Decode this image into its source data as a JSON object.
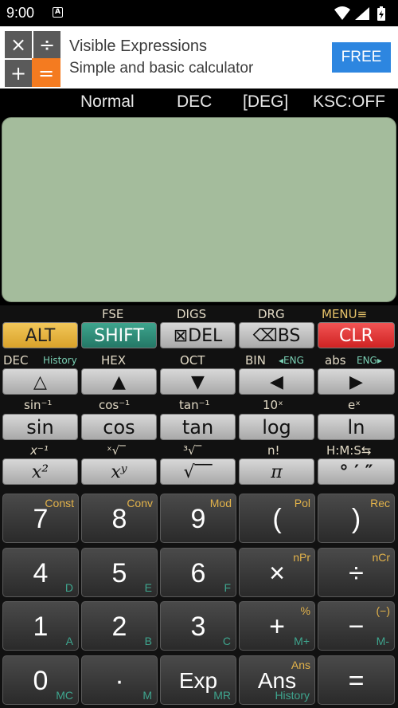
{
  "status": {
    "time": "9:00",
    "notif_icon": "A"
  },
  "ad": {
    "title": "Visible Expressions",
    "subtitle": "Simple and basic calculator",
    "button": "FREE",
    "logo_symbols": [
      "×",
      "÷",
      "+",
      "="
    ]
  },
  "modes": {
    "notation": "Normal",
    "base": "DEC",
    "angle": "[DEG]",
    "ksc": "KSC:OFF"
  },
  "row1": {
    "labels": [
      "FSE",
      "DIGS",
      "DRG",
      "MENU≡"
    ],
    "keys": [
      "ALT",
      "SHIFT",
      "⊠DEL",
      "⌫BS",
      "CLR"
    ]
  },
  "row2": {
    "labels": [
      "DEC",
      "History",
      "HEX",
      "OCT",
      "BIN",
      "◂ENG",
      "abs",
      "ENG▸"
    ],
    "keys": [
      "△",
      "▲",
      "▼",
      "◀",
      "▶"
    ]
  },
  "row3": {
    "labels": [
      "sin⁻¹",
      "cos⁻¹",
      "tan⁻¹",
      "10ˣ",
      "eˣ"
    ],
    "keys": [
      "sin",
      "cos",
      "tan",
      "log",
      "ln"
    ]
  },
  "row4": {
    "labels": [
      "x⁻¹",
      "ˣ√‾",
      "³√‾",
      "n!",
      "H:M:S⇆"
    ],
    "keys": [
      "x²",
      "xʸ",
      "√‾‾",
      "π",
      "° ′ ″"
    ]
  },
  "numpad": [
    [
      {
        "main": "7",
        "top": "Const",
        "bot": ""
      },
      {
        "main": "8",
        "top": "Conv",
        "bot": ""
      },
      {
        "main": "9",
        "top": "Mod",
        "bot": ""
      },
      {
        "main": "(",
        "top": "Pol",
        "bot": ""
      },
      {
        "main": ")",
        "top": "Rec",
        "bot": ""
      }
    ],
    [
      {
        "main": "4",
        "top": "",
        "bot": "D"
      },
      {
        "main": "5",
        "top": "",
        "bot": "E"
      },
      {
        "main": "6",
        "top": "",
        "bot": "F"
      },
      {
        "main": "×",
        "top": "nPr",
        "bot": ""
      },
      {
        "main": "÷",
        "top": "nCr",
        "bot": ""
      }
    ],
    [
      {
        "main": "1",
        "top": "",
        "bot": "A"
      },
      {
        "main": "2",
        "top": "",
        "bot": "B"
      },
      {
        "main": "3",
        "top": "",
        "bot": "C"
      },
      {
        "main": "+",
        "top": "%",
        "bot": "M+"
      },
      {
        "main": "−",
        "top": "(−)",
        "bot": "M-"
      }
    ],
    [
      {
        "main": "0",
        "top": "",
        "bot": "MC"
      },
      {
        "main": "·",
        "top": "",
        "bot": "M"
      },
      {
        "main": "Exp",
        "top": "",
        "bot": "MR"
      },
      {
        "main": "Ans",
        "top": "Ans",
        "bot": "History"
      },
      {
        "main": "=",
        "top": "",
        "bot": ""
      }
    ]
  ]
}
